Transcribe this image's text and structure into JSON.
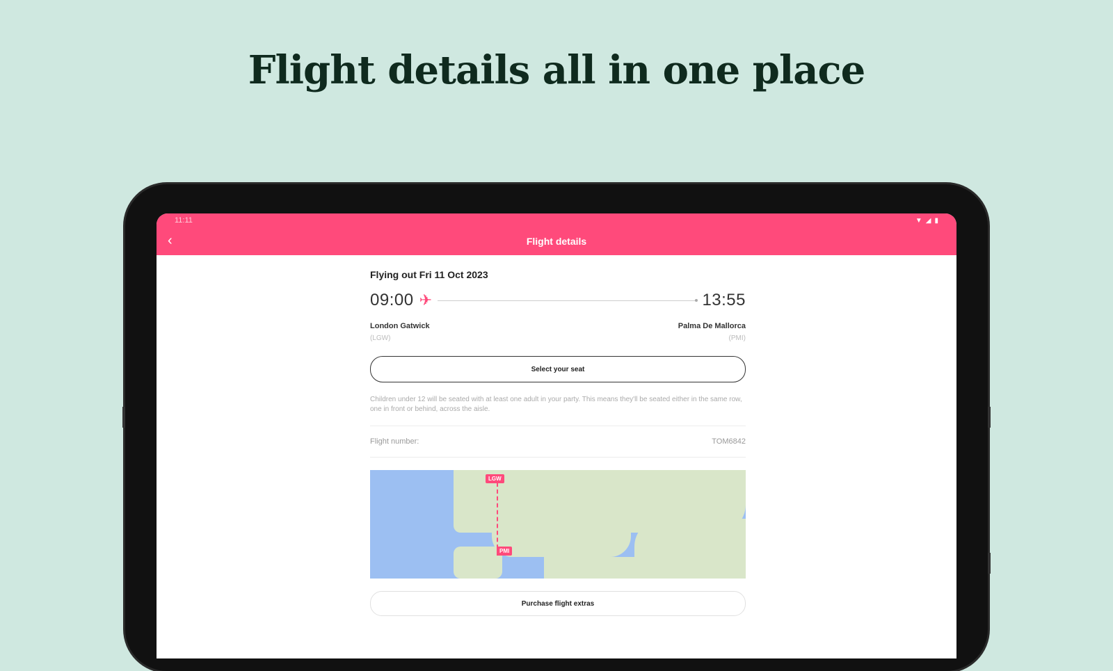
{
  "headline": "Flight details all in one place",
  "status_bar": {
    "time": "11:11",
    "icons": [
      "wifi-icon",
      "signal-icon",
      "battery-icon"
    ]
  },
  "app_bar": {
    "title": "Flight details",
    "back_icon": "chevron-left-icon"
  },
  "flight": {
    "date_label": "Flying out Fri 11 Oct 2023",
    "depart_time": "09:00",
    "arrive_time": "13:55",
    "origin_name": "London Gatwick",
    "origin_code": "(LGW)",
    "dest_name": "Palma De Mallorca",
    "dest_code": "(PMI)"
  },
  "seat_button": "Select your seat",
  "note": "Children under 12 will be seated with at least one adult in your party. This means they'll be seated either in the same row, one in front or behind, across the aisle.",
  "flight_number": {
    "label": "Flight number:",
    "value": "TOM6842"
  },
  "map": {
    "origin_pin": "LGW",
    "dest_pin": "PMI"
  },
  "extras_button": "Purchase flight extras",
  "colors": {
    "accent": "#ff4a7b",
    "background": "#cfe8e0",
    "headline": "#0f2a1e"
  }
}
